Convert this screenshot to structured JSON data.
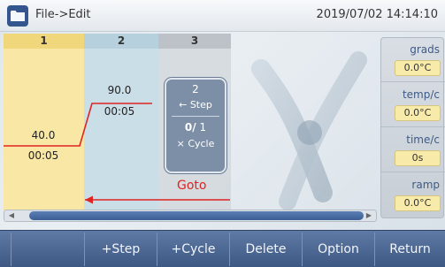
{
  "titlebar": {
    "icon": "folder-icon",
    "title": "File->Edit",
    "datetime": "2019/07/02 14:14:10"
  },
  "columns": [
    {
      "number": "1",
      "temperature": "40.0",
      "time": "00:05"
    },
    {
      "number": "2",
      "temperature": "90.0",
      "time": "00:05"
    },
    {
      "number": "3"
    }
  ],
  "cycle_box": {
    "goto_step": "2",
    "step_label": "← Step",
    "current_cycle": "0/",
    "total_cycles": "1",
    "cycle_label": "× Cycle"
  },
  "goto_label": "Goto",
  "params": [
    {
      "label": "grads",
      "value": "0.0°C"
    },
    {
      "label": "temp/c",
      "value": "0.0°C"
    },
    {
      "label": "time/c",
      "value": "0s"
    },
    {
      "label": "ramp",
      "value": "0.0°C"
    }
  ],
  "toolbar": {
    "buttons": [
      "+Step",
      "+Cycle",
      "Delete",
      "Option",
      "Return"
    ]
  },
  "colors": {
    "profile_line": "#e02323",
    "toolbar_bg": "#4a6793",
    "step1_bg": "#f9e7a5",
    "step2_bg": "#c9dee7",
    "param_value_bg": "#f8eaa9"
  }
}
